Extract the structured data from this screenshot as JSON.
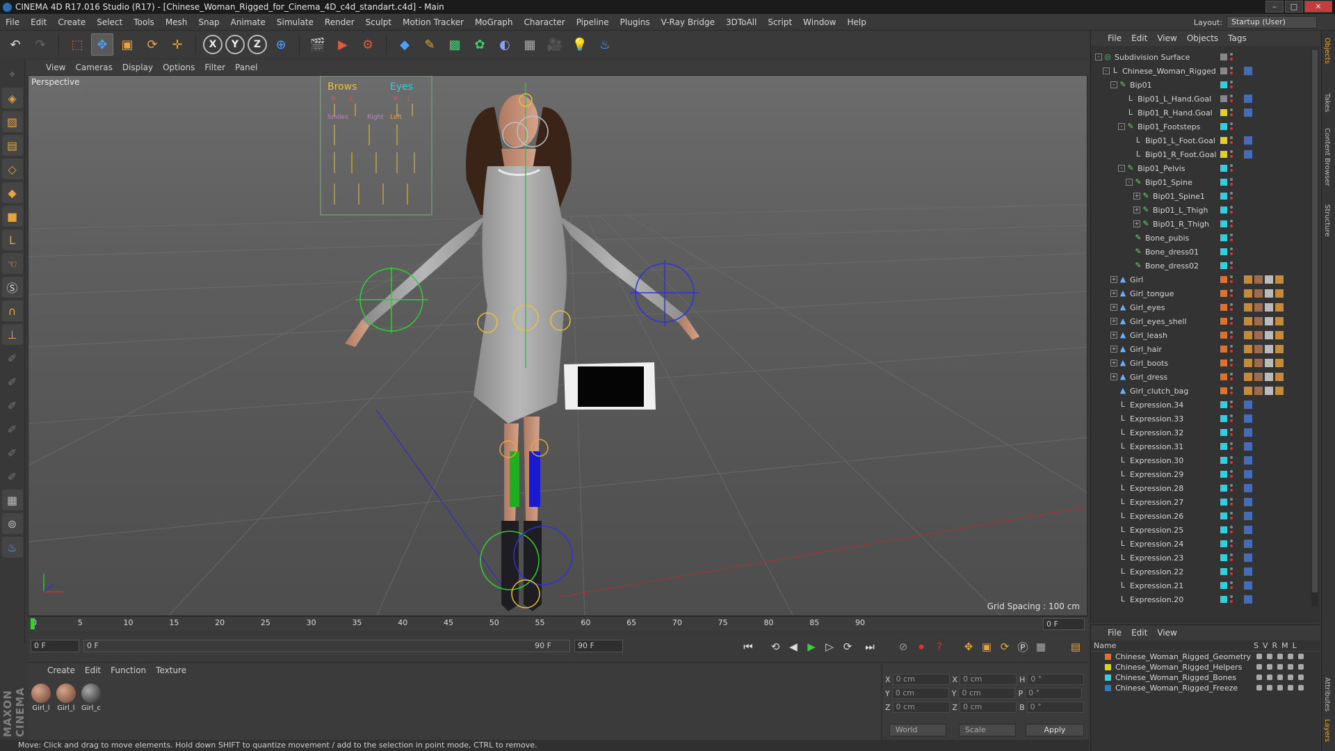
{
  "window": {
    "title": "CINEMA 4D R17.016 Studio (R17) - [Chinese_Woman_Rigged_for_Cinema_4D_c4d_standart.c4d] - Main"
  },
  "menubar": {
    "items": [
      "File",
      "Edit",
      "Create",
      "Select",
      "Tools",
      "Mesh",
      "Snap",
      "Animate",
      "Simulate",
      "Render",
      "Sculpt",
      "Motion Tracker",
      "MoGraph",
      "Character",
      "Pipeline",
      "Plugins",
      "V-Ray Bridge",
      "3DToAll",
      "Script",
      "Window",
      "Help"
    ],
    "layout_label": "Layout:",
    "layout_value": "Startup (User)"
  },
  "viewport": {
    "menu": [
      "View",
      "Cameras",
      "Display",
      "Options",
      "Filter",
      "Panel"
    ],
    "label": "Perspective",
    "grid_spacing": "Grid Spacing : 100 cm",
    "rig_labels": [
      "Brows",
      "Eyes",
      "R",
      "L",
      "R",
      "L",
      "Smiles",
      "Right",
      "Left"
    ]
  },
  "timeline": {
    "ticks": [
      "0",
      "5",
      "10",
      "15",
      "20",
      "25",
      "30",
      "35",
      "40",
      "45",
      "50",
      "55",
      "60",
      "65",
      "70",
      "75",
      "80",
      "85",
      "90"
    ],
    "current_frame": "0 F"
  },
  "transport": {
    "start_field": "0 F",
    "slider_start": "0 F",
    "slider_end": "90 F",
    "end_field": "90 F"
  },
  "material_manager": {
    "menu": [
      "Create",
      "Edit",
      "Function",
      "Texture"
    ],
    "materials": [
      "Girl_l",
      "Girl_l",
      "Girl_c"
    ]
  },
  "coordinates": {
    "rows": [
      {
        "a": "X",
        "av": "0 cm",
        "b": "X",
        "bv": "0 cm",
        "c": "H",
        "cv": "0 °"
      },
      {
        "a": "Y",
        "av": "0 cm",
        "b": "Y",
        "bv": "0 cm",
        "c": "P",
        "cv": "0 °"
      },
      {
        "a": "Z",
        "av": "0 cm",
        "b": "Z",
        "bv": "0 cm",
        "c": "B",
        "cv": "0 °"
      }
    ],
    "space": "World",
    "mode": "Scale",
    "apply": "Apply"
  },
  "status": "Move: Click and drag to move elements. Hold down SHIFT to quantize movement / add to the selection in point mode, CTRL to remove.",
  "object_manager": {
    "menu": [
      "File",
      "Edit",
      "View",
      "Objects",
      "Tags"
    ],
    "objects": [
      {
        "name": "Subdivision Surface",
        "depth": 0,
        "exp": "-",
        "icon": "subdiv",
        "tag": "#888888"
      },
      {
        "name": "Chinese_Woman_Rigged",
        "depth": 1,
        "exp": "-",
        "icon": "null",
        "tag": "#888888"
      },
      {
        "name": "Bip01",
        "depth": 2,
        "exp": "-",
        "icon": "bone",
        "tag": "#2fd0e0"
      },
      {
        "name": "Bip01_L_Hand.Goal",
        "depth": 3,
        "exp": "",
        "icon": "null",
        "tag": "#888888"
      },
      {
        "name": "Bip01_R_Hand.Goal",
        "depth": 3,
        "exp": "",
        "icon": "null",
        "tag": "#e0d020"
      },
      {
        "name": "Bip01_Footsteps",
        "depth": 3,
        "exp": "-",
        "icon": "bone",
        "tag": "#2fd0e0"
      },
      {
        "name": "Bip01_L_Foot.Goal",
        "depth": 4,
        "exp": "",
        "icon": "null",
        "tag": "#e0d020"
      },
      {
        "name": "Bip01_R_Foot.Goal",
        "depth": 4,
        "exp": "",
        "icon": "null",
        "tag": "#e0d020"
      },
      {
        "name": "Bip01_Pelvis",
        "depth": 3,
        "exp": "-",
        "icon": "bone",
        "tag": "#2fd0e0"
      },
      {
        "name": "Bip01_Spine",
        "depth": 4,
        "exp": "-",
        "icon": "bone",
        "tag": "#2fd0e0"
      },
      {
        "name": "Bip01_Spine1",
        "depth": 5,
        "exp": "+",
        "icon": "bone",
        "tag": "#2fd0e0"
      },
      {
        "name": "Bip01_L_Thigh",
        "depth": 5,
        "exp": "+",
        "icon": "bone",
        "tag": "#2fd0e0"
      },
      {
        "name": "Bip01_R_Thigh",
        "depth": 5,
        "exp": "+",
        "icon": "bone",
        "tag": "#2fd0e0"
      },
      {
        "name": "Bone_pubis",
        "depth": 4,
        "exp": "",
        "icon": "bone",
        "tag": "#2fd0e0"
      },
      {
        "name": "Bone_dress01",
        "depth": 4,
        "exp": "",
        "icon": "bone",
        "tag": "#2fd0e0"
      },
      {
        "name": "Bone_dress02",
        "depth": 4,
        "exp": "",
        "icon": "bone",
        "tag": "#2fd0e0"
      },
      {
        "name": "Girl",
        "depth": 2,
        "exp": "+",
        "icon": "poly",
        "tag": "#e0702a"
      },
      {
        "name": "Girl_tongue",
        "depth": 2,
        "exp": "+",
        "icon": "poly",
        "tag": "#e0702a"
      },
      {
        "name": "Girl_eyes",
        "depth": 2,
        "exp": "+",
        "icon": "poly",
        "tag": "#e0702a"
      },
      {
        "name": "Girl_eyes_shell",
        "depth": 2,
        "exp": "+",
        "icon": "poly",
        "tag": "#e0702a"
      },
      {
        "name": "Girl_leash",
        "depth": 2,
        "exp": "+",
        "icon": "poly",
        "tag": "#e0702a"
      },
      {
        "name": "Girl_hair",
        "depth": 2,
        "exp": "+",
        "icon": "poly",
        "tag": "#e0702a"
      },
      {
        "name": "Girl_boots",
        "depth": 2,
        "exp": "+",
        "icon": "poly",
        "tag": "#e0702a"
      },
      {
        "name": "Girl_dress",
        "depth": 2,
        "exp": "+",
        "icon": "poly",
        "tag": "#e0702a"
      },
      {
        "name": "Girl_clutch_bag",
        "depth": 2,
        "exp": "",
        "icon": "poly",
        "tag": "#e0702a"
      },
      {
        "name": "Expression.34",
        "depth": 2,
        "exp": "",
        "icon": "null",
        "tag": "#2fd0e0"
      },
      {
        "name": "Expression.33",
        "depth": 2,
        "exp": "",
        "icon": "null",
        "tag": "#2fd0e0"
      },
      {
        "name": "Expression.32",
        "depth": 2,
        "exp": "",
        "icon": "null",
        "tag": "#2fd0e0"
      },
      {
        "name": "Expression.31",
        "depth": 2,
        "exp": "",
        "icon": "null",
        "tag": "#2fd0e0"
      },
      {
        "name": "Expression.30",
        "depth": 2,
        "exp": "",
        "icon": "null",
        "tag": "#2fd0e0"
      },
      {
        "name": "Expression.29",
        "depth": 2,
        "exp": "",
        "icon": "null",
        "tag": "#2fd0e0"
      },
      {
        "name": "Expression.28",
        "depth": 2,
        "exp": "",
        "icon": "null",
        "tag": "#2fd0e0"
      },
      {
        "name": "Expression.27",
        "depth": 2,
        "exp": "",
        "icon": "null",
        "tag": "#2fd0e0"
      },
      {
        "name": "Expression.26",
        "depth": 2,
        "exp": "",
        "icon": "null",
        "tag": "#2fd0e0"
      },
      {
        "name": "Expression.25",
        "depth": 2,
        "exp": "",
        "icon": "null",
        "tag": "#2fd0e0"
      },
      {
        "name": "Expression.24",
        "depth": 2,
        "exp": "",
        "icon": "null",
        "tag": "#2fd0e0"
      },
      {
        "name": "Expression.23",
        "depth": 2,
        "exp": "",
        "icon": "null",
        "tag": "#2fd0e0"
      },
      {
        "name": "Expression.22",
        "depth": 2,
        "exp": "",
        "icon": "null",
        "tag": "#2fd0e0"
      },
      {
        "name": "Expression.21",
        "depth": 2,
        "exp": "",
        "icon": "null",
        "tag": "#2fd0e0"
      },
      {
        "name": "Expression.20",
        "depth": 2,
        "exp": "",
        "icon": "null",
        "tag": "#2fd0e0"
      }
    ]
  },
  "layer_manager": {
    "menu": [
      "File",
      "Edit",
      "View"
    ],
    "columns": [
      "Name",
      "S",
      "V",
      "R",
      "M",
      "L"
    ],
    "layers": [
      {
        "name": "Chinese_Woman_Rigged_Geometry",
        "color": "#e0702a"
      },
      {
        "name": "Chinese_Woman_Rigged_Helpers",
        "color": "#e0d020"
      },
      {
        "name": "Chinese_Woman_Rigged_Bones",
        "color": "#2fd0e0"
      },
      {
        "name": "Chinese_Woman_Rigged_Freeze",
        "color": "#2a7ad0"
      }
    ]
  },
  "side_tabs": [
    "Objects",
    "Takes",
    "Content Browser",
    "Structure",
    "Attributes",
    "Layers"
  ],
  "brand": "MAXON CINEMA 4D"
}
